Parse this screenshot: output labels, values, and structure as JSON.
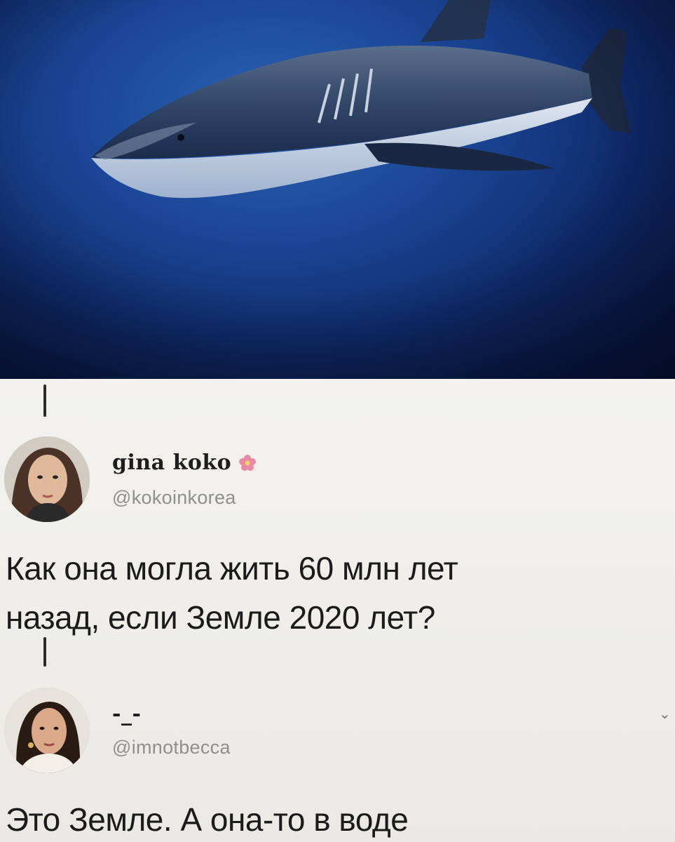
{
  "photo": {
    "subject": "shark-underwater-photo"
  },
  "tweets": [
    {
      "display_name": "gina koko",
      "name_icon": "pink-flower-icon",
      "handle": "@kokoinkorea",
      "text_lines": [
        "Как она могла жить 60 млн лет",
        "назад, если Земле 2020 лет?"
      ]
    },
    {
      "display_name": "-_-",
      "handle": "@imnotbecca",
      "text_lines": [
        "Это Земле. А она-то в воде"
      ]
    }
  ],
  "colors": {
    "water_deep": "#081647",
    "water_light": "#2b62b3",
    "text": "#1b1b1b",
    "handle": "#8f8f8f",
    "flower": "#e88aa6"
  }
}
